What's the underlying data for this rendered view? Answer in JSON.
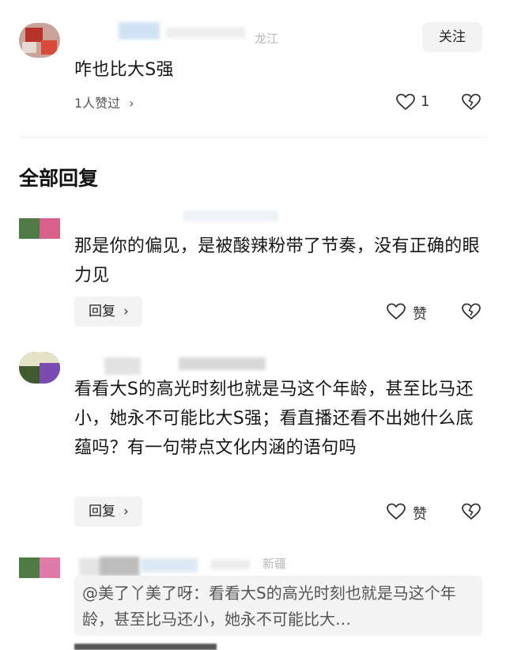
{
  "comment": {
    "location": "龙江",
    "follow_label": "关注",
    "text": "咋也比大S强",
    "liked_by": "1人赞过",
    "like_count": "1"
  },
  "section_title": "全部回复",
  "replies": [
    {
      "text": "那是你的偏见，是被酸辣粉带了节奏，没有正确的眼力见",
      "reply_label": "回复",
      "like_label": "赞"
    },
    {
      "text": "看看大S的高光时刻也就是马这个年龄，甚至比马还小，她永不可能比大S强；看直播还看不出她什么底蕴吗？有一句带点文化内涵的语句吗",
      "reply_label": "回复",
      "like_label": "赞"
    },
    {
      "location": "新疆",
      "quote": "@美了丫美了呀：看看大S的高光时刻也就是马这个年龄，甚至比马还小，她永不可能比大…"
    }
  ],
  "icons": {
    "chevron": "chevron-right-icon",
    "heart": "heart-icon",
    "dislike": "broken-heart-icon"
  }
}
